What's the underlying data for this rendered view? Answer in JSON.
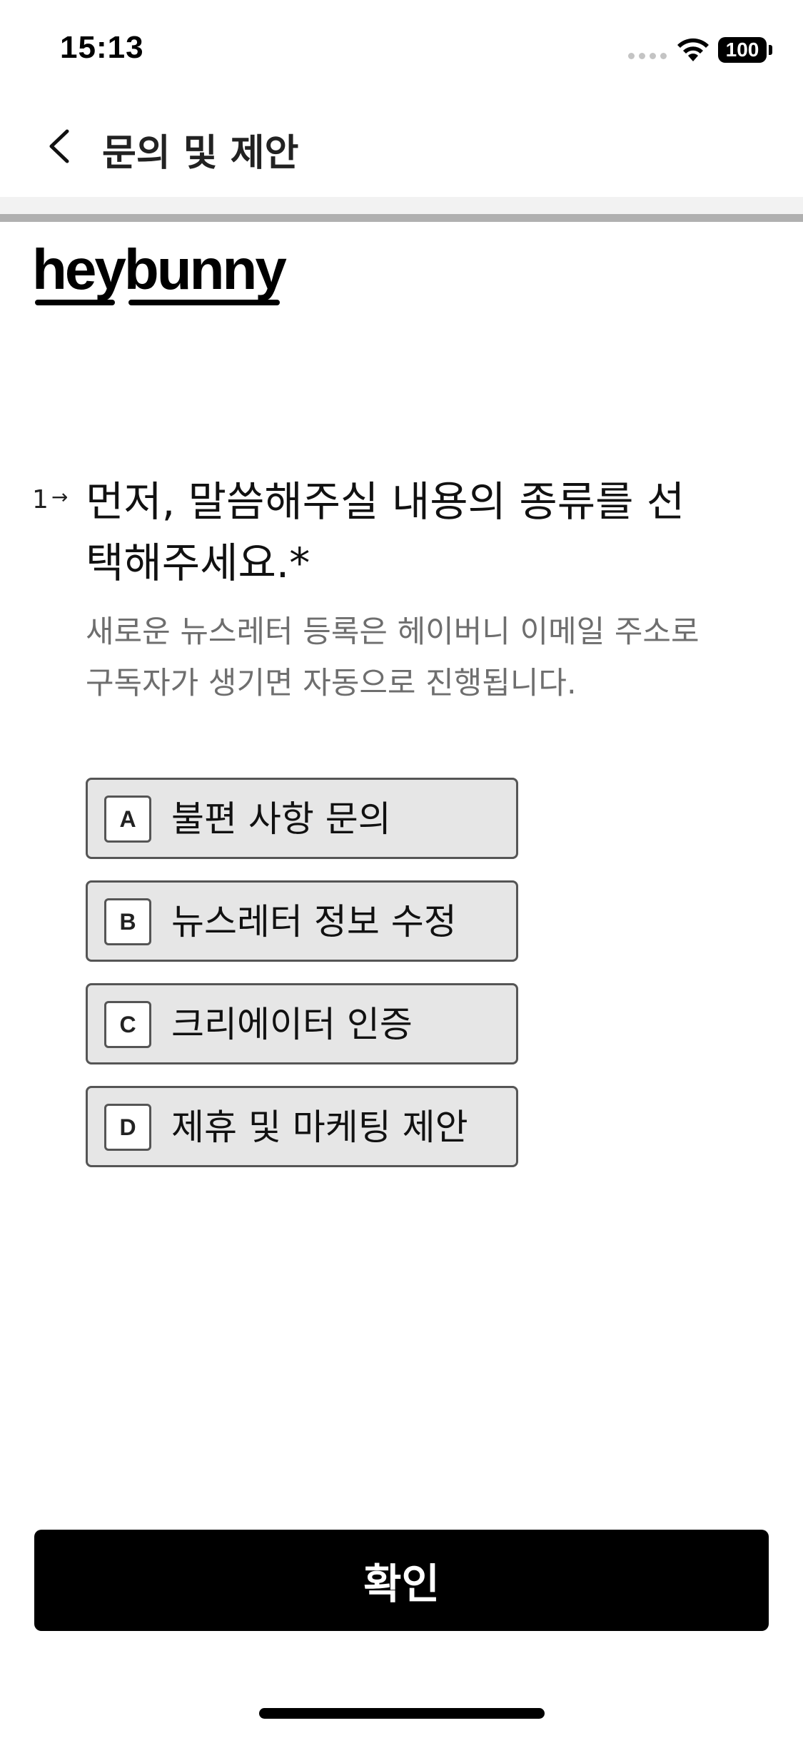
{
  "status_bar": {
    "time": "15:13",
    "battery": "100",
    "icons": [
      "signal-icon",
      "wifi-icon",
      "battery-icon"
    ]
  },
  "nav": {
    "title": "문의 및 제안",
    "back_icon": "chevron-left-icon"
  },
  "logo": {
    "text": "heybunny"
  },
  "question": {
    "number": "1",
    "arrow": "→",
    "text": "먼저, 말씀해주실 내용의 종류를 선택해주세요.*",
    "description": "새로운 뉴스레터 등록은 헤이버니 이메일 주소로 구독자가 생기면 자동으로 진행됩니다."
  },
  "options": [
    {
      "key": "A",
      "label": "불편 사항 문의"
    },
    {
      "key": "B",
      "label": "뉴스레터 정보 수정"
    },
    {
      "key": "C",
      "label": "크리에이터 인증"
    },
    {
      "key": "D",
      "label": "제휴 및 마케팅 제안"
    }
  ],
  "confirm_button": {
    "label": "확인"
  },
  "colors": {
    "accent": "#000000",
    "option_bg": "#e6e6e6",
    "option_border": "#555555",
    "description": "#6e6e6e"
  }
}
